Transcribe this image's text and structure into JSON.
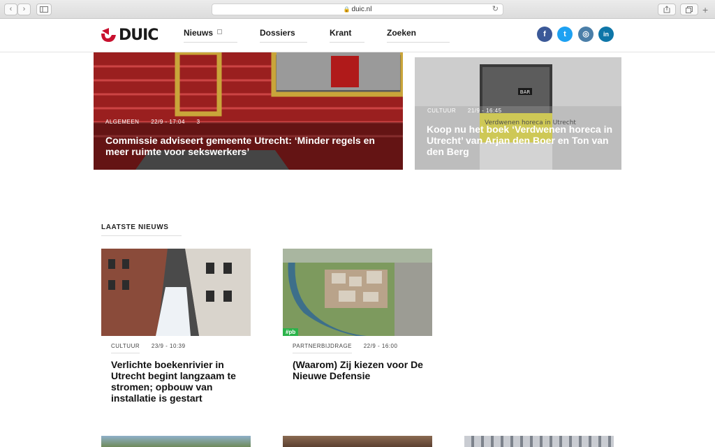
{
  "browser": {
    "url": "duic.nl",
    "back_icon": "‹",
    "forward_icon": "›"
  },
  "header": {
    "logo_text": "DUIC",
    "menu": [
      {
        "label": "Nieuws"
      },
      {
        "label": "Dossiers"
      },
      {
        "label": "Krant"
      },
      {
        "label": "Zoeken"
      }
    ],
    "social": [
      {
        "name": "facebook",
        "glyph": "f",
        "color": "#3b5998"
      },
      {
        "name": "twitter",
        "glyph": "t",
        "color": "#1da1f2"
      },
      {
        "name": "instagram",
        "glyph": "◎",
        "color": "#4a7ea8"
      },
      {
        "name": "linkedin",
        "glyph": "in",
        "color": "#0e76a8"
      }
    ]
  },
  "hero": [
    {
      "category": "ALGEMEEN",
      "date": "22/9 - 17:04",
      "comments": "3",
      "title": "Commissie adviseert gemeente Utrecht: ‘Minder regels en meer ruimte voor sekswerkers’"
    },
    {
      "category": "CULTUUR",
      "date": "21/9 - 16:45",
      "title": "Koop nu het boek ‘Verdwenen horeca in Utrecht’ van Arjan den Boer en Ton van den Berg",
      "book_cover_text": "Verdwenen horeca in Utrecht",
      "book_sign": "BAR"
    }
  ],
  "latest": {
    "heading": "LAATSTE NIEUWS",
    "items": [
      {
        "category": "CULTUUR",
        "date": "23/9 - 10:39",
        "title": "Verlichte boekenrivier in Utrecht begint langzaam te stromen; opbouw van installatie is gestart"
      },
      {
        "category": "PARTNERBIJDRAGE",
        "date": "22/9 - 16:00",
        "title": "(Waarom) Zij kiezen voor De Nieuwe Defensie",
        "badge": "#pb"
      }
    ]
  }
}
